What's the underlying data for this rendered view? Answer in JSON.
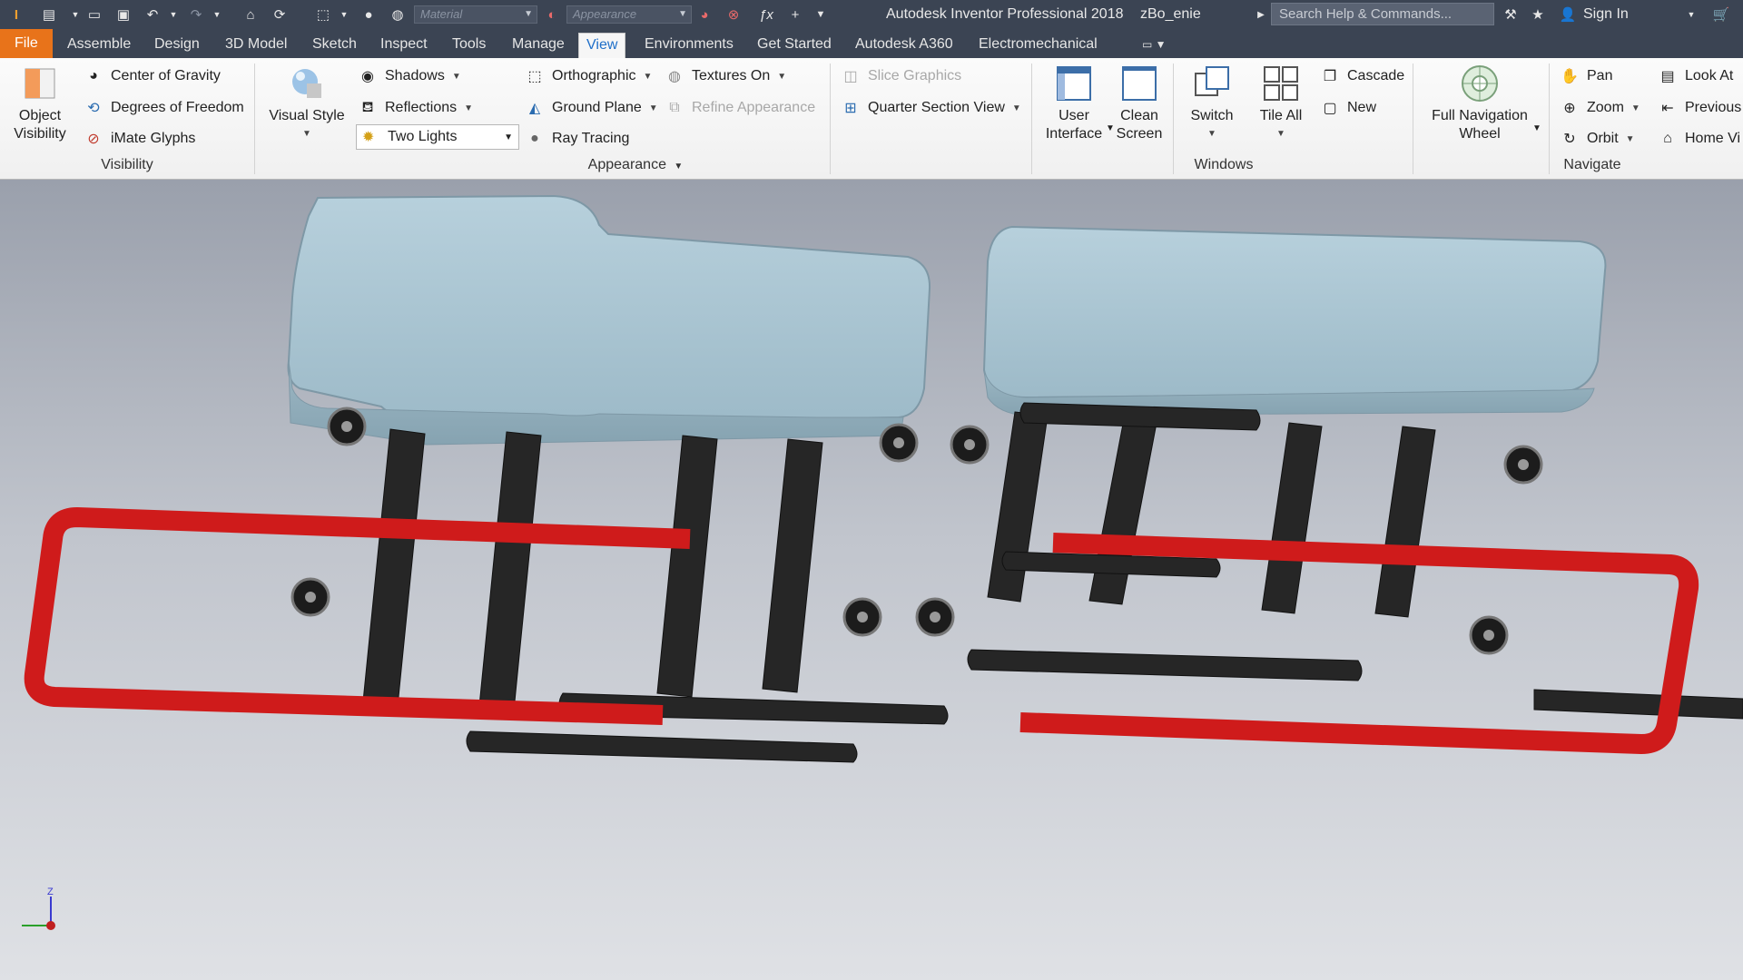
{
  "quick_access": {
    "material_placeholder": "Material",
    "appearance_placeholder": "Appearance",
    "app_title": "Autodesk Inventor Professional 2018",
    "document": "zBo_enie",
    "search_placeholder": "Search Help & Commands...",
    "sign_in": "Sign In"
  },
  "tabs": [
    {
      "label": "File"
    },
    {
      "label": "Assemble"
    },
    {
      "label": "Design"
    },
    {
      "label": "3D Model"
    },
    {
      "label": "Sketch"
    },
    {
      "label": "Inspect"
    },
    {
      "label": "Tools"
    },
    {
      "label": "Manage"
    },
    {
      "label": "View"
    },
    {
      "label": "Environments"
    },
    {
      "label": "Get Started"
    },
    {
      "label": "Autodesk A360"
    },
    {
      "label": "Electromechanical"
    }
  ],
  "active_tab": "View",
  "ribbon": {
    "visibility": {
      "title": "Visibility",
      "object_visibility": [
        "Object",
        "Visibility"
      ],
      "center_of_gravity": "Center of Gravity",
      "degrees_of_freedom": "Degrees of Freedom",
      "imate_glyphs": "iMate Glyphs"
    },
    "appearance": {
      "title": "Appearance",
      "visual_style": "Visual Style",
      "shadows": "Shadows",
      "reflections": "Reflections",
      "lights_value": "Two Lights",
      "orthographic": "Orthographic",
      "ground_plane": "Ground Plane",
      "ray_tracing": "Ray Tracing",
      "textures_on": "Textures On",
      "refine_appearance": "Refine Appearance",
      "slice_graphics": "Slice Graphics",
      "quarter_section_view": "Quarter Section View"
    },
    "windows": {
      "title": "Windows",
      "user_interface": [
        "User",
        "Interface"
      ],
      "clean_screen": [
        "Clean",
        "Screen"
      ],
      "switch": "Switch",
      "tile_all": "Tile All",
      "cascade": "Cascade",
      "new": "New"
    },
    "navigate": {
      "title": "Navigate",
      "full_navigation_wheel": [
        "Full Navigation",
        "Wheel"
      ],
      "pan": "Pan",
      "zoom": "Zoom",
      "orbit": "Orbit",
      "look_at": "Look At",
      "previous": "Previous",
      "home_view": "Home Vi"
    }
  },
  "colors": {
    "titlebar": "#3b4453",
    "file_tab": "#e8731a",
    "active_tab_text": "#1f6fc9",
    "cushion": "#a9c4d0",
    "frame_red": "#cf1b1b",
    "bracket_black": "#262626"
  },
  "viewport": {
    "triad_label": "Z"
  }
}
